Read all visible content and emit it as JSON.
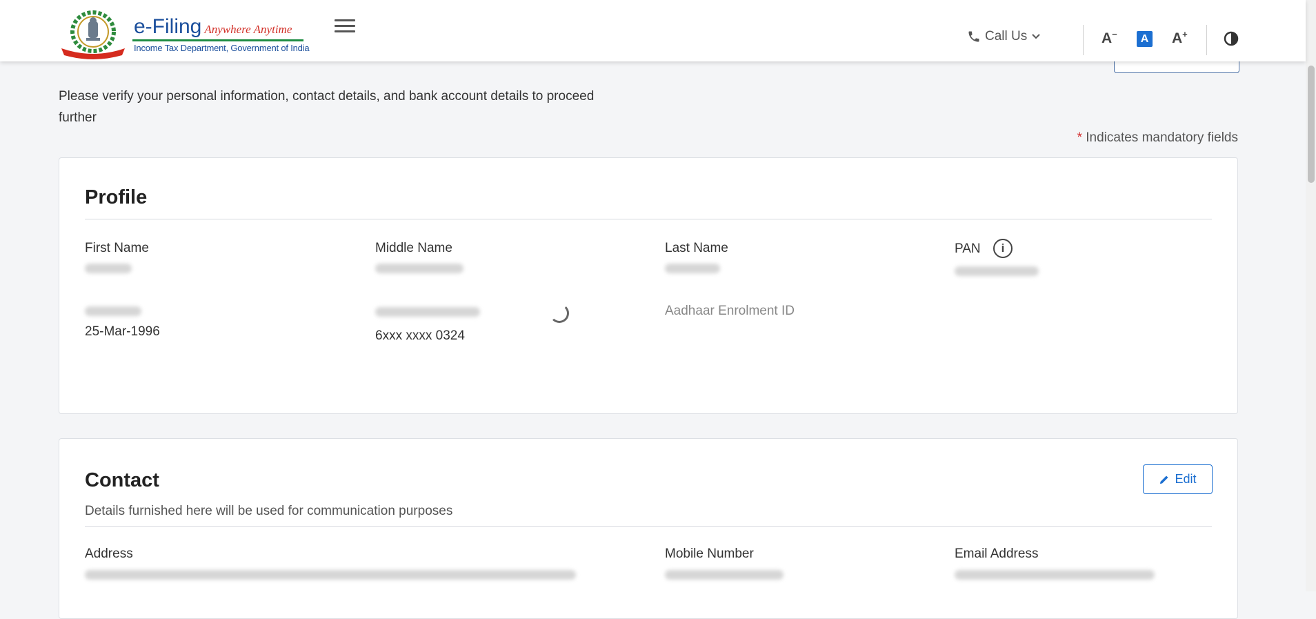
{
  "header": {
    "brand_title": "e-Filing",
    "brand_tagline": "Anywhere Anytime",
    "brand_subtitle": "Income Tax Department, Government of India",
    "call_us": "Call Us",
    "font_decrease": "A",
    "font_normal": "A",
    "font_increase": "A",
    "icons": [
      "national-emblem-icon",
      "hamburger-menu-icon",
      "phone-icon",
      "chevron-down-icon",
      "contrast-icon"
    ],
    "colors": {
      "brand_blue": "#1b4f9c",
      "tagline_red": "#d22f27",
      "accent": "#1c6fd1"
    }
  },
  "page": {
    "intro": "Please verify your personal information, contact details, and bank account details to proceed further",
    "mandatory_star": "*",
    "mandatory_note": "Indicates mandatory fields"
  },
  "profile": {
    "title": "Profile",
    "first_name_label": "First Name",
    "middle_name_label": "Middle Name",
    "last_name_label": "Last Name",
    "pan_label": "PAN",
    "dob_value": "25-Mar-1996",
    "aadhaar_value": "6xxx xxxx 0324",
    "aadhaar_enrolment_label": "Aadhaar Enrolment ID"
  },
  "contact": {
    "title": "Contact",
    "edit_label": "Edit",
    "subtitle": "Details furnished here will be used for communication purposes",
    "address_label": "Address",
    "mobile_label": "Mobile Number",
    "email_label": "Email Address"
  }
}
